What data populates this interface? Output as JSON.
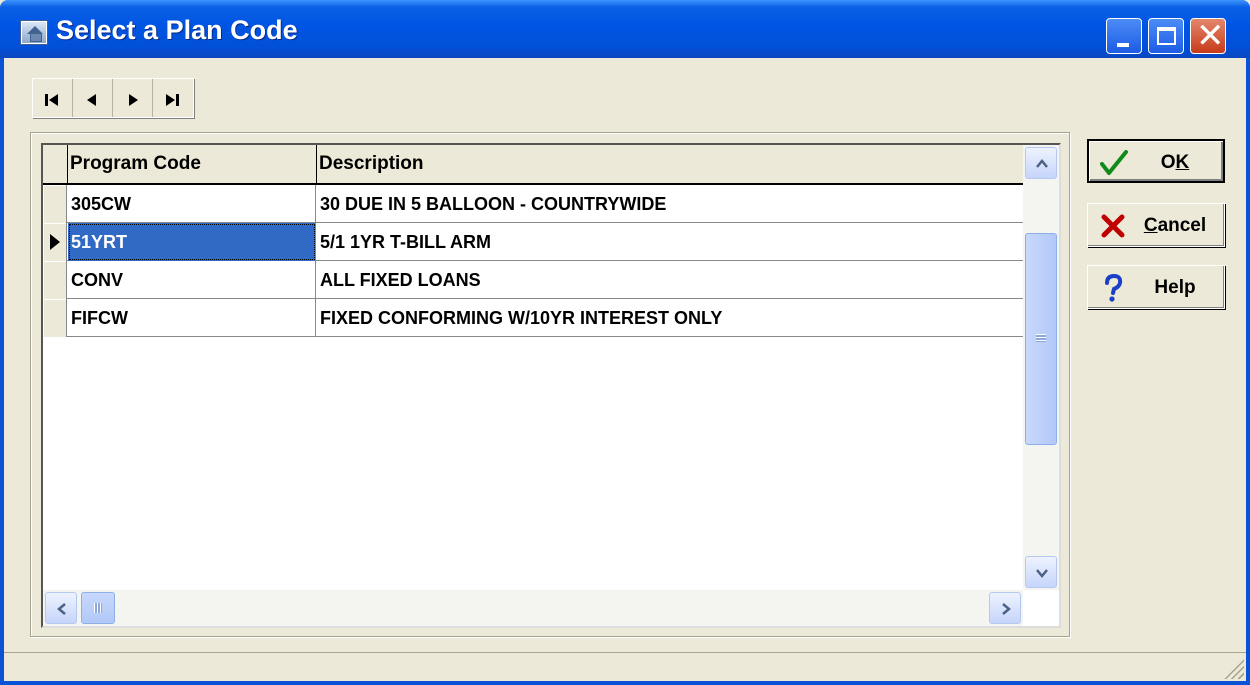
{
  "window": {
    "title": "Select a Plan Code"
  },
  "grid": {
    "columns": [
      "Program Code",
      "Description"
    ],
    "rows": [
      {
        "code": "305CW",
        "description": "30 DUE IN 5 BALLOON - COUNTRYWIDE"
      },
      {
        "code": "51YRT",
        "description": "5/1 1YR T-BILL ARM"
      },
      {
        "code": "CONV",
        "description": "ALL FIXED LOANS"
      },
      {
        "code": "FIFCW",
        "description": "FIXED CONFORMING W/10YR INTEREST ONLY"
      }
    ],
    "selected_row": 1
  },
  "buttons": {
    "ok": {
      "pre": "O",
      "underline": "K",
      "post": ""
    },
    "cancel": {
      "pre": "",
      "underline": "C",
      "post": "ancel"
    },
    "help": {
      "label": "Help"
    }
  },
  "icons": {
    "nav": [
      "first-record-icon",
      "prior-record-icon",
      "next-record-icon",
      "last-record-icon"
    ],
    "ok": "checkmark-icon",
    "cancel": "x-icon",
    "help": "question-mark-icon"
  },
  "colors": {
    "titlebar": "#0054e3",
    "selection": "#316ac5",
    "face": "#ece9d8",
    "close": "#c63a1a"
  }
}
